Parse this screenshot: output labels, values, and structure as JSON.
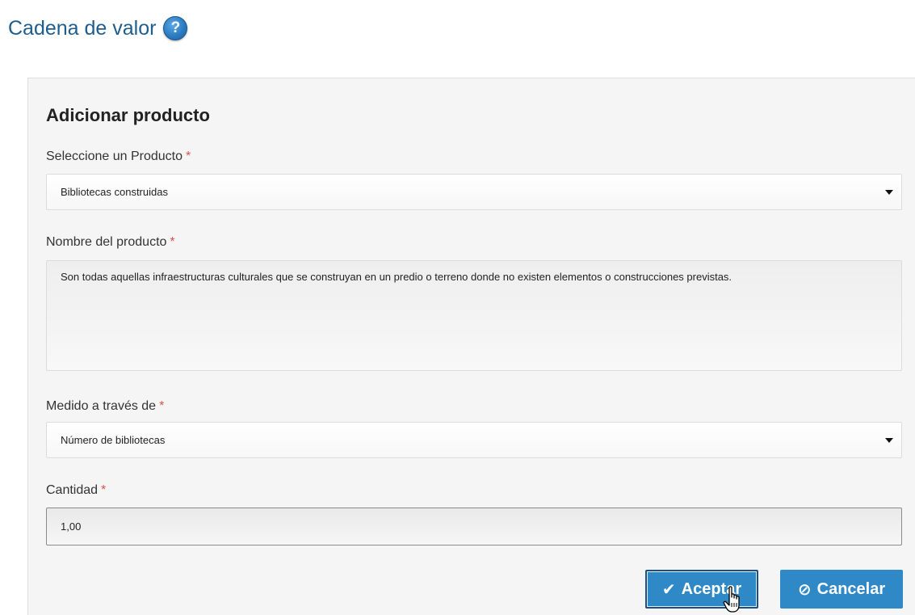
{
  "header": {
    "title": "Cadena de valor",
    "help_icon": "?"
  },
  "form": {
    "title": "Adicionar producto",
    "required_mark": "*",
    "product_select": {
      "label": "Seleccione un Producto",
      "value": "Bibliotecas construidas"
    },
    "product_name": {
      "label": "Nombre del producto",
      "value": "Son todas aquellas infraestructuras culturales que se construyan en un predio o terreno donde no existen elementos o construcciones previstas."
    },
    "measured_by": {
      "label": "Medido a través de",
      "value": "Número de bibliotecas"
    },
    "quantity": {
      "label": "Cantidad",
      "value": "1,00"
    }
  },
  "actions": {
    "accept_label": "Aceptar",
    "accept_icon": "✔",
    "cancel_label": "Cancelar",
    "cancel_icon": "⊘"
  },
  "colors": {
    "title": "#1f5d8f",
    "button": "#2e89c6",
    "required": "#d9534f"
  }
}
